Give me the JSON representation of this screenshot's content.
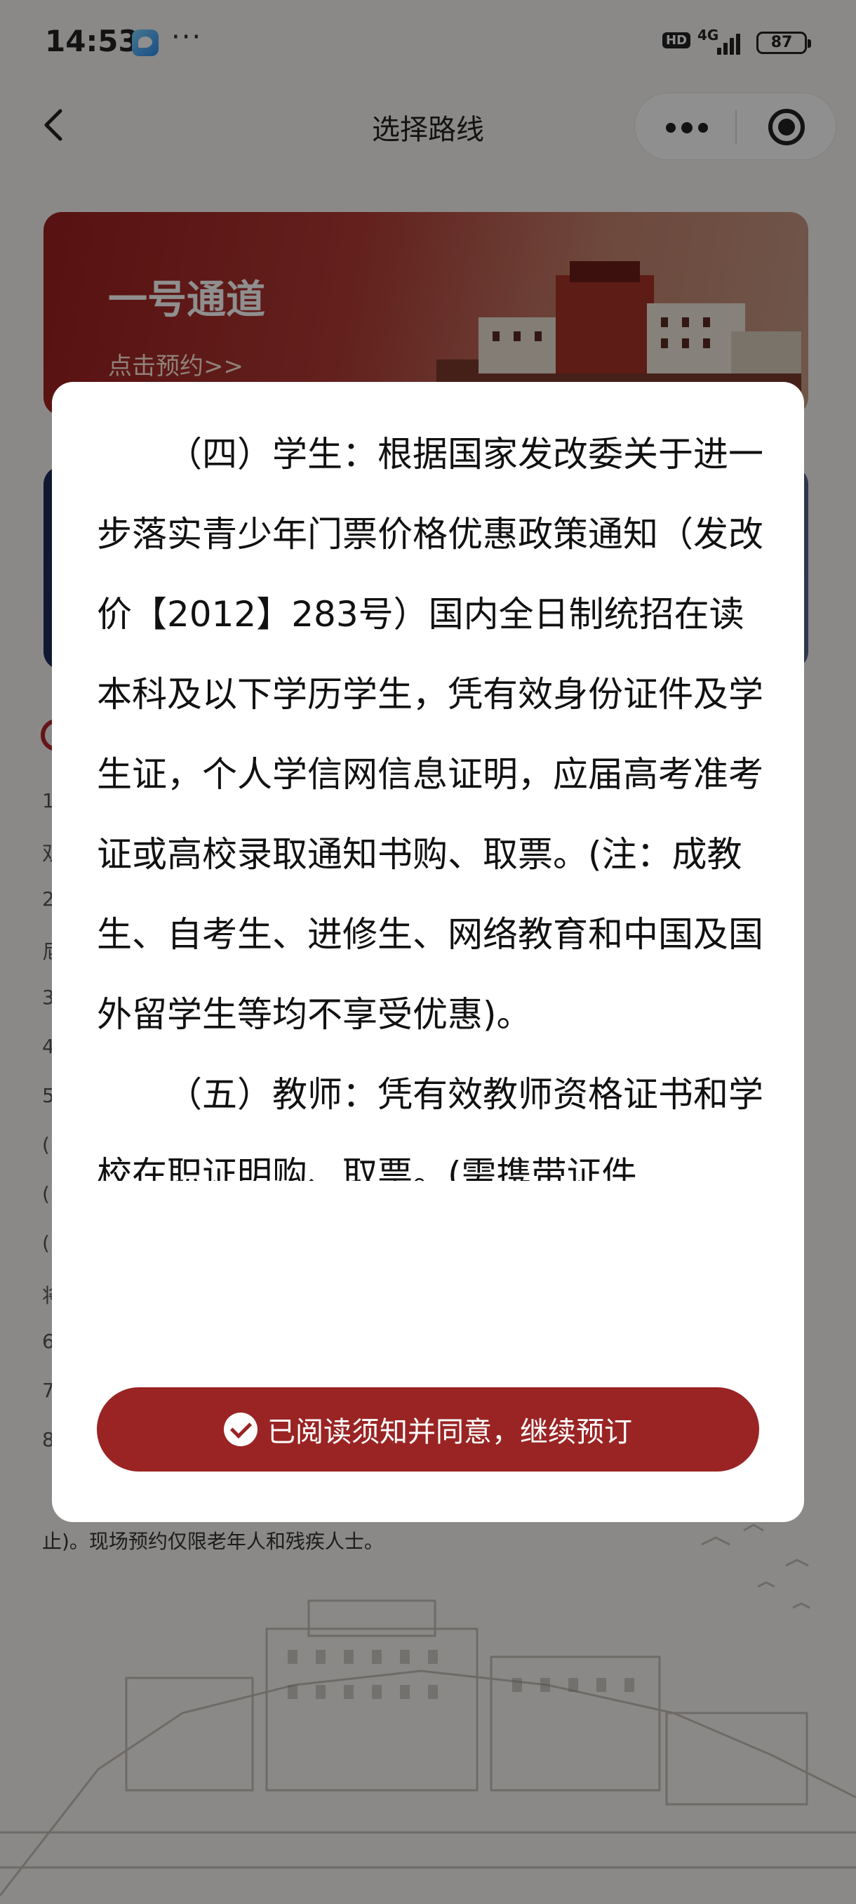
{
  "status_bar": {
    "time": "14:53",
    "more": "···",
    "hd": "HD",
    "network": "4G",
    "battery": "87"
  },
  "nav": {
    "title": "选择路线"
  },
  "route_cards": [
    {
      "title": "一号通道",
      "subtitle": "点击预约>>"
    },
    {
      "title": "",
      "subtitle": ""
    }
  ],
  "notice_fragments": [
    "1",
    "双",
    "2",
    "尼",
    "3",
    "4",
    "5",
    "(",
    "(",
    "(",
    "将",
    "6",
    "7",
    "8"
  ],
  "notice_bottom_line": "止)。现场预约仅限老年人和残疾人士。",
  "modal": {
    "paragraphs": [
      "（四）学生：根据国家发改委关于进一步落实青少年门票价格优惠政策通知（发改价【2012】283号）国内全日制统招在读本科及以下学历学生，凭有效身份证件及学生证，个人学信网信息证明，应届高考准考证或高校录取通知书购、取票。(注：成教生、自考生、进修生、网络教育和中国及国外留学生等均不享受优惠)。",
      "（五）教师：凭有效教师资格证书和学校在职证明购、取票。(需携带证件"
    ],
    "agree_label": "已阅读须知并同意，继续预订"
  },
  "colors": {
    "accent": "#9a2424",
    "mask": "rgba(0,0,0,0.44)",
    "card_red": "#9d1f1f",
    "card_blue": "#1d2b57"
  },
  "icons": {
    "back": "chevron-left-icon",
    "more": "more-dots-icon",
    "close": "target-close-icon",
    "check": "check-circle-icon"
  }
}
